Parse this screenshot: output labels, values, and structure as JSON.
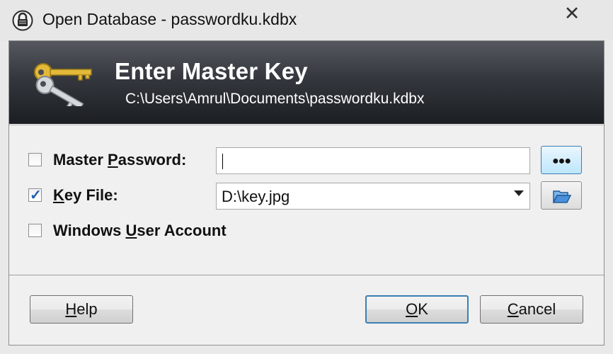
{
  "window": {
    "title": "Open Database - passwordku.kdbx",
    "close_glyph": "✕",
    "icon": "keepass-lock-icon"
  },
  "banner": {
    "title": "Enter Master Key",
    "path": "C:\\Users\\Amrul\\Documents\\passwordku.kdbx",
    "icon": "keys-icon"
  },
  "master_password": {
    "label_pre": "Master ",
    "label_accel": "P",
    "label_post": "assword:",
    "checked": false,
    "value": "",
    "reveal_label": "●●●"
  },
  "key_file": {
    "label_accel": "K",
    "label_post": "ey File:",
    "checked": true,
    "check_glyph": "✓",
    "selected": "D:\\key.jpg",
    "browse_icon": "folder-open-icon"
  },
  "windows_account": {
    "label_pre": "Windows ",
    "label_accel": "U",
    "label_post": "ser Account",
    "checked": false
  },
  "buttons": {
    "help_accel": "H",
    "help_rest": "elp",
    "ok_accel": "O",
    "ok_rest": "K",
    "cancel_accel": "C",
    "cancel_rest": "ancel"
  },
  "colors": {
    "banner_top": "#55595f",
    "banner_bottom": "#1b1e22",
    "focus_blue": "#3c7fb1",
    "check_blue": "#1f5fad"
  }
}
